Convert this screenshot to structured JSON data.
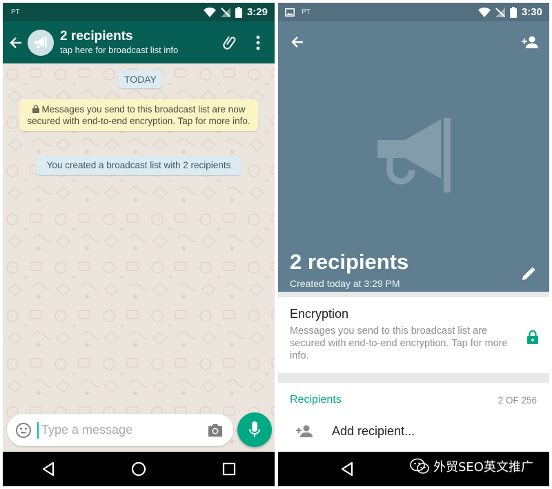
{
  "left_screen": {
    "status_bar": {
      "carrier": "PT",
      "time": "3:29"
    },
    "toolbar": {
      "title": "2 recipients",
      "subtitle": "tap here for broadcast list info"
    },
    "chat": {
      "date_chip": "TODAY",
      "encryption_notice": "Messages you send to this broadcast list are now secured with end-to-end encryption. Tap for more info.",
      "system_message": "You created a broadcast list with 2 recipients"
    },
    "composer": {
      "placeholder": "Type a message"
    }
  },
  "right_screen": {
    "status_bar": {
      "carrier": "PT",
      "time": "3:30"
    },
    "header": {
      "title": "2 recipients",
      "created": "Created today at 3:29 PM"
    },
    "encryption": {
      "title": "Encryption",
      "description": "Messages you send to this broadcast list are secured with end-to-end encryption. Tap for more info."
    },
    "recipients": {
      "header": "Recipients",
      "count": "2 OF 256",
      "add_label": "Add recipient..."
    }
  },
  "watermark": {
    "text": "外贸SEO英文推广"
  },
  "colors": {
    "whatsapp_teal": "#075e54",
    "accent_green": "#00a884",
    "info_header": "#5f7f91",
    "chat_background": "#ece5dd"
  },
  "icons": [
    "back-arrow-icon",
    "megaphone-icon",
    "paperclip-icon",
    "more-vert-icon",
    "lock-icon",
    "emoji-icon",
    "camera-icon",
    "mic-icon",
    "add-person-icon",
    "edit-pencil-icon",
    "wifi-icon",
    "no-signal-icon",
    "battery-icon",
    "gallery-icon",
    "nav-back-icon",
    "nav-home-icon",
    "nav-recents-icon",
    "wechat-icon"
  ]
}
